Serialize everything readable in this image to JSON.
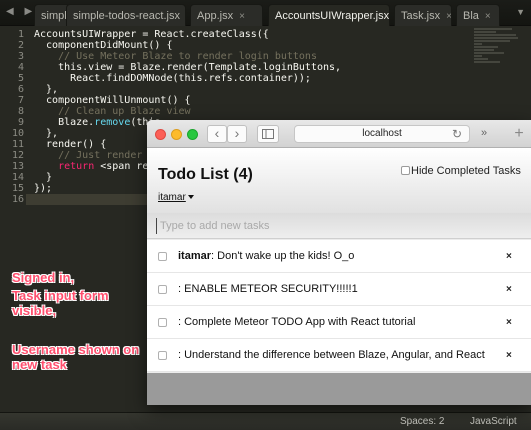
{
  "editor": {
    "tabs": [
      {
        "label": "simpl",
        "close": ""
      },
      {
        "label": "simple-todos-react.jsx",
        "close": "×"
      },
      {
        "label": "App.jsx",
        "close": "×"
      },
      {
        "label": "AccountsUIWrapper.jsx",
        "close": "×"
      },
      {
        "label": "Task.jsx",
        "close": "×"
      },
      {
        "label": "Bla",
        "close": "×"
      }
    ],
    "line_numbers": [
      "1",
      "2",
      "3",
      "4",
      "5",
      "6",
      "7",
      "8",
      "9",
      "10",
      "11",
      "12",
      "13",
      "14",
      "15",
      "16"
    ],
    "lines": {
      "l1a": "AccountsUIWrapper = React.createClass({",
      "l2a": "  componentDidMount() {",
      "l3a": "    // Use Meteor Blaze to render login buttons",
      "l4a": "    this.view = Blaze.render(Template.loginButtons,",
      "l5a": "      React.findDOMNode(this.refs.container));",
      "l6a": "  },",
      "l7a": "  componentWillUnmount() {",
      "l8a": "    // Clean up Blaze view",
      "l9a": "    Blaze.",
      "l9b": "remove",
      "l9c": "(this.",
      "l10a": "  },",
      "l11a": "  render() {",
      "l12a": "    // Just render a",
      "l13a": "    ",
      "l13b": "return",
      "l13c": " <span ref=",
      "l14a": "  }",
      "l15a": "});",
      "l16a": ""
    },
    "status": {
      "spaces": "Spaces: 2",
      "syntax": "JavaScript"
    }
  },
  "annotations": {
    "signed_in": "Signed in,",
    "task_input": "Task input form visible,",
    "username": "Username shown on new task"
  },
  "browser": {
    "url": "localhost",
    "back_glyph": "‹",
    "forward_glyph": "›",
    "reload_glyph": "↻",
    "more_glyph": "»",
    "newtab_glyph": "+"
  },
  "app": {
    "title": "Todo List (4)",
    "hide_completed_label": "Hide Completed Tasks",
    "username": "itamar",
    "new_task_placeholder": "Type to add new tasks",
    "delete_glyph": "×",
    "tasks": [
      {
        "user": "itamar",
        "text": ": Don't wake up the kids! O_o"
      },
      {
        "user": "",
        "text": ": ENABLE METEOR SECURITY!!!!!1"
      },
      {
        "user": "",
        "text": ": Complete Meteor TODO App with React tutorial"
      },
      {
        "user": "",
        "text": ": Understand the difference between Blaze, Angular, and React"
      }
    ]
  },
  "colors": {
    "editor_bg": "#272822",
    "annotation": "#ff4f6e",
    "comment": "#75715e",
    "keyword": "#f92672",
    "traffic_red": "#fc5f57",
    "traffic_yellow": "#fdbb2d",
    "traffic_green": "#28c73f"
  }
}
